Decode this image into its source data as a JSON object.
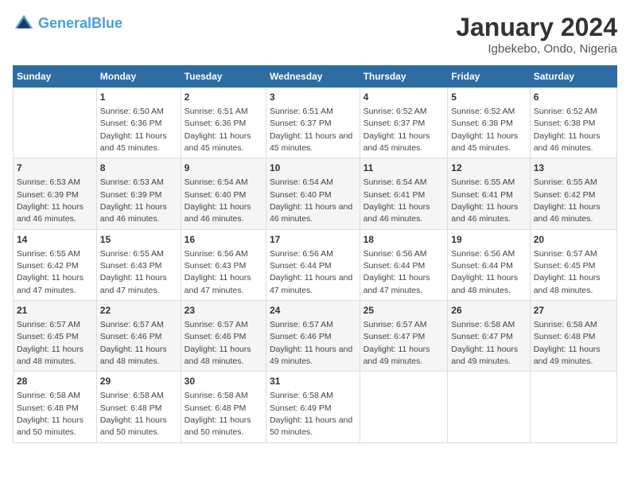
{
  "header": {
    "logo_line1": "General",
    "logo_line2": "Blue",
    "title": "January 2024",
    "subtitle": "Igbekebo, Ondo, Nigeria"
  },
  "days_of_week": [
    "Sunday",
    "Monday",
    "Tuesday",
    "Wednesday",
    "Thursday",
    "Friday",
    "Saturday"
  ],
  "weeks": [
    [
      {
        "day": "",
        "sunrise": "",
        "sunset": "",
        "daylight": ""
      },
      {
        "day": "1",
        "sunrise": "Sunrise: 6:50 AM",
        "sunset": "Sunset: 6:36 PM",
        "daylight": "Daylight: 11 hours and 45 minutes."
      },
      {
        "day": "2",
        "sunrise": "Sunrise: 6:51 AM",
        "sunset": "Sunset: 6:36 PM",
        "daylight": "Daylight: 11 hours and 45 minutes."
      },
      {
        "day": "3",
        "sunrise": "Sunrise: 6:51 AM",
        "sunset": "Sunset: 6:37 PM",
        "daylight": "Daylight: 11 hours and 45 minutes."
      },
      {
        "day": "4",
        "sunrise": "Sunrise: 6:52 AM",
        "sunset": "Sunset: 6:37 PM",
        "daylight": "Daylight: 11 hours and 45 minutes."
      },
      {
        "day": "5",
        "sunrise": "Sunrise: 6:52 AM",
        "sunset": "Sunset: 6:38 PM",
        "daylight": "Daylight: 11 hours and 45 minutes."
      },
      {
        "day": "6",
        "sunrise": "Sunrise: 6:52 AM",
        "sunset": "Sunset: 6:38 PM",
        "daylight": "Daylight: 11 hours and 46 minutes."
      }
    ],
    [
      {
        "day": "7",
        "sunrise": "Sunrise: 6:53 AM",
        "sunset": "Sunset: 6:39 PM",
        "daylight": "Daylight: 11 hours and 46 minutes."
      },
      {
        "day": "8",
        "sunrise": "Sunrise: 6:53 AM",
        "sunset": "Sunset: 6:39 PM",
        "daylight": "Daylight: 11 hours and 46 minutes."
      },
      {
        "day": "9",
        "sunrise": "Sunrise: 6:54 AM",
        "sunset": "Sunset: 6:40 PM",
        "daylight": "Daylight: 11 hours and 46 minutes."
      },
      {
        "day": "10",
        "sunrise": "Sunrise: 6:54 AM",
        "sunset": "Sunset: 6:40 PM",
        "daylight": "Daylight: 11 hours and 46 minutes."
      },
      {
        "day": "11",
        "sunrise": "Sunrise: 6:54 AM",
        "sunset": "Sunset: 6:41 PM",
        "daylight": "Daylight: 11 hours and 46 minutes."
      },
      {
        "day": "12",
        "sunrise": "Sunrise: 6:55 AM",
        "sunset": "Sunset: 6:41 PM",
        "daylight": "Daylight: 11 hours and 46 minutes."
      },
      {
        "day": "13",
        "sunrise": "Sunrise: 6:55 AM",
        "sunset": "Sunset: 6:42 PM",
        "daylight": "Daylight: 11 hours and 46 minutes."
      }
    ],
    [
      {
        "day": "14",
        "sunrise": "Sunrise: 6:55 AM",
        "sunset": "Sunset: 6:42 PM",
        "daylight": "Daylight: 11 hours and 47 minutes."
      },
      {
        "day": "15",
        "sunrise": "Sunrise: 6:55 AM",
        "sunset": "Sunset: 6:43 PM",
        "daylight": "Daylight: 11 hours and 47 minutes."
      },
      {
        "day": "16",
        "sunrise": "Sunrise: 6:56 AM",
        "sunset": "Sunset: 6:43 PM",
        "daylight": "Daylight: 11 hours and 47 minutes."
      },
      {
        "day": "17",
        "sunrise": "Sunrise: 6:56 AM",
        "sunset": "Sunset: 6:44 PM",
        "daylight": "Daylight: 11 hours and 47 minutes."
      },
      {
        "day": "18",
        "sunrise": "Sunrise: 6:56 AM",
        "sunset": "Sunset: 6:44 PM",
        "daylight": "Daylight: 11 hours and 47 minutes."
      },
      {
        "day": "19",
        "sunrise": "Sunrise: 6:56 AM",
        "sunset": "Sunset: 6:44 PM",
        "daylight": "Daylight: 11 hours and 48 minutes."
      },
      {
        "day": "20",
        "sunrise": "Sunrise: 6:57 AM",
        "sunset": "Sunset: 6:45 PM",
        "daylight": "Daylight: 11 hours and 48 minutes."
      }
    ],
    [
      {
        "day": "21",
        "sunrise": "Sunrise: 6:57 AM",
        "sunset": "Sunset: 6:45 PM",
        "daylight": "Daylight: 11 hours and 48 minutes."
      },
      {
        "day": "22",
        "sunrise": "Sunrise: 6:57 AM",
        "sunset": "Sunset: 6:46 PM",
        "daylight": "Daylight: 11 hours and 48 minutes."
      },
      {
        "day": "23",
        "sunrise": "Sunrise: 6:57 AM",
        "sunset": "Sunset: 6:46 PM",
        "daylight": "Daylight: 11 hours and 48 minutes."
      },
      {
        "day": "24",
        "sunrise": "Sunrise: 6:57 AM",
        "sunset": "Sunset: 6:46 PM",
        "daylight": "Daylight: 11 hours and 49 minutes."
      },
      {
        "day": "25",
        "sunrise": "Sunrise: 6:57 AM",
        "sunset": "Sunset: 6:47 PM",
        "daylight": "Daylight: 11 hours and 49 minutes."
      },
      {
        "day": "26",
        "sunrise": "Sunrise: 6:58 AM",
        "sunset": "Sunset: 6:47 PM",
        "daylight": "Daylight: 11 hours and 49 minutes."
      },
      {
        "day": "27",
        "sunrise": "Sunrise: 6:58 AM",
        "sunset": "Sunset: 6:48 PM",
        "daylight": "Daylight: 11 hours and 49 minutes."
      }
    ],
    [
      {
        "day": "28",
        "sunrise": "Sunrise: 6:58 AM",
        "sunset": "Sunset: 6:48 PM",
        "daylight": "Daylight: 11 hours and 50 minutes."
      },
      {
        "day": "29",
        "sunrise": "Sunrise: 6:58 AM",
        "sunset": "Sunset: 6:48 PM",
        "daylight": "Daylight: 11 hours and 50 minutes."
      },
      {
        "day": "30",
        "sunrise": "Sunrise: 6:58 AM",
        "sunset": "Sunset: 6:48 PM",
        "daylight": "Daylight: 11 hours and 50 minutes."
      },
      {
        "day": "31",
        "sunrise": "Sunrise: 6:58 AM",
        "sunset": "Sunset: 6:49 PM",
        "daylight": "Daylight: 11 hours and 50 minutes."
      },
      {
        "day": "",
        "sunrise": "",
        "sunset": "",
        "daylight": ""
      },
      {
        "day": "",
        "sunrise": "",
        "sunset": "",
        "daylight": ""
      },
      {
        "day": "",
        "sunrise": "",
        "sunset": "",
        "daylight": ""
      }
    ]
  ]
}
